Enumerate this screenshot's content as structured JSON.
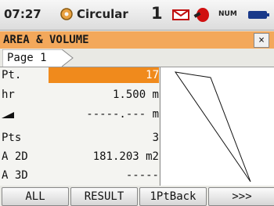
{
  "status": {
    "time": "07:27",
    "mode": "Circular",
    "face": "1",
    "num": "NUM"
  },
  "title": {
    "text": "AREA & VOLUME",
    "close": "×"
  },
  "tabs": [
    {
      "label": "Page 1"
    }
  ],
  "rows": [
    {
      "label": "Pt.",
      "value": "17",
      "selected": true
    },
    {
      "label": "hr",
      "value": "1.500 m"
    },
    {
      "label": "",
      "icon": "slope-icon",
      "value": "-----.--- m"
    },
    {
      "label": "Pts",
      "value": "3"
    },
    {
      "label": "A 2D",
      "value": "181.203 m2"
    },
    {
      "label": "A 3D",
      "value": "-----"
    }
  ],
  "softkeys": [
    "ALL",
    "RESULT",
    "1PtBack",
    ">>>"
  ],
  "colors": {
    "title_bar": "#f3a85b",
    "selected_field": "#f08a1c",
    "status_icons": "#d01010"
  },
  "icons": [
    "gear-icon",
    "envelope-icon",
    "satellite-icon",
    "battery-icon",
    "slope-icon",
    "close-icon"
  ]
}
